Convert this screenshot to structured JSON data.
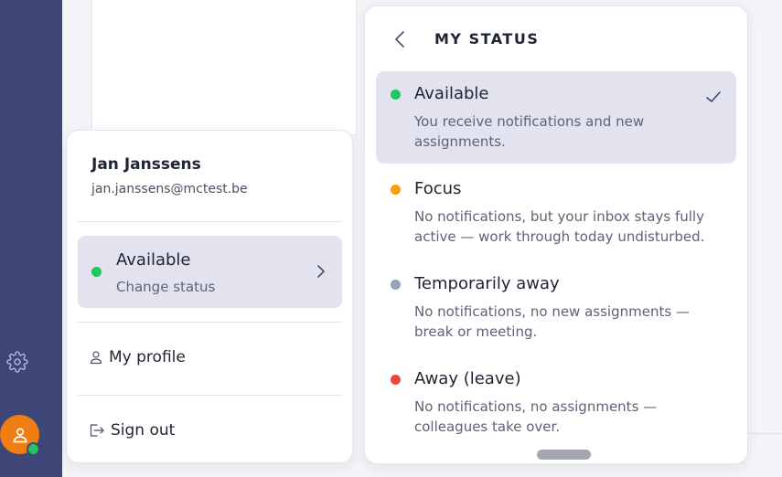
{
  "sidebar": {
    "settings_icon": "gear-icon",
    "avatar_icon": "user-icon",
    "avatar_color": "#f07e14",
    "presence_color": "#22c55e"
  },
  "profile": {
    "name": "Jan Janssens",
    "email": "jan.janssens@mctest.be",
    "current_status": {
      "label": "Available",
      "sub_label": "Change status",
      "color": "#22c55e"
    },
    "menu": [
      {
        "label": "My profile",
        "icon": "person-icon"
      },
      {
        "label": "Sign out",
        "icon": "sign-out-icon"
      }
    ]
  },
  "status_panel": {
    "title": "MY STATUS",
    "back_icon": "chevron-left-icon",
    "options": [
      {
        "label": "Available",
        "description": "You receive notifications and new assignments.",
        "color": "#22c55e",
        "selected": true
      },
      {
        "label": "Focus",
        "description": "No notifications, but your inbox stays fully active — work through today undisturbed.",
        "color": "#f59e0b",
        "selected": false
      },
      {
        "label": "Temporarily away",
        "description": "No notifications, no new assignments — break or meeting.",
        "color": "#94a3b8",
        "selected": false
      },
      {
        "label": "Away (leave)",
        "description": "No notifications, no assignments — colleagues take over.",
        "color": "#ef4444",
        "selected": false
      }
    ]
  }
}
